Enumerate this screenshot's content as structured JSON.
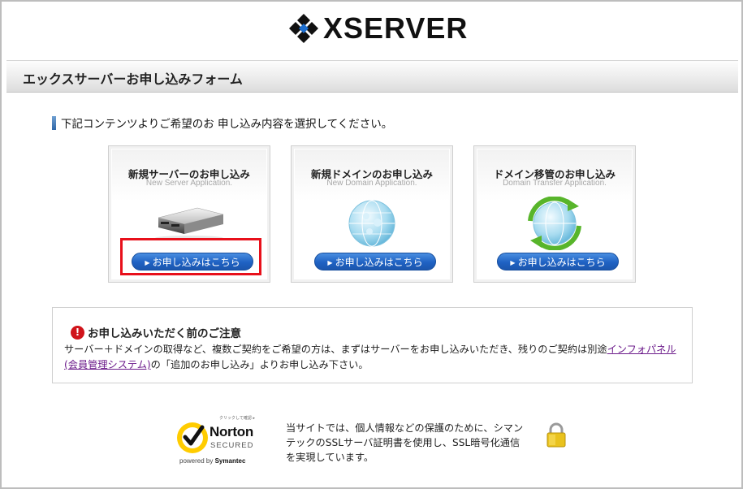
{
  "logo": {
    "text": "XSERVER"
  },
  "titlebar": {
    "title": "エックスサーバーお申し込みフォーム"
  },
  "section": {
    "heading": "下記コンテンツよりご希望のお 申し込み内容を選択してください。"
  },
  "cards": [
    {
      "title": "新規サーバーのお申し込み",
      "subtitle": "New Server Application.",
      "button": "お申し込みはこちら",
      "icon": "server-icon"
    },
    {
      "title": "新規ドメインのお申し込み",
      "subtitle": "New Domain Application.",
      "button": "お申し込みはこちら",
      "icon": "globe-icon"
    },
    {
      "title": "ドメイン移管のお申し込み",
      "subtitle": "Domain Transfer Application.",
      "button": "お申し込みはこちら",
      "icon": "globe-transfer-icon"
    }
  ],
  "notice": {
    "title": "お申し込みいただく前のご注意",
    "text1": "サーバー＋ドメインの取得など、複数ご契約をご希望の方は、まずはサーバーをお申し込みいただき、残りのご契約は別途",
    "link": "インフォパネル(会員管理システム)",
    "text2": "の「追加のお申し込み」よりお申し込み下さい。"
  },
  "norton": {
    "tiny": "クリックして確認 ▸",
    "brand": "Norton",
    "secured": "SECURED",
    "powered_prefix": "powered by ",
    "powered_brand": "Symantec"
  },
  "ssl": {
    "line1": "当サイトでは、個人情報などの保護のために、シマン",
    "line2": "テックのSSLサーバ証明書を使用し、SSL暗号化通信",
    "line3": "を実現しています。"
  },
  "colors": {
    "accent_blue": "#1f62c3",
    "highlight_red": "#e8101b",
    "warning_red": "#d0131a",
    "link_purple": "#6b1a8a"
  }
}
